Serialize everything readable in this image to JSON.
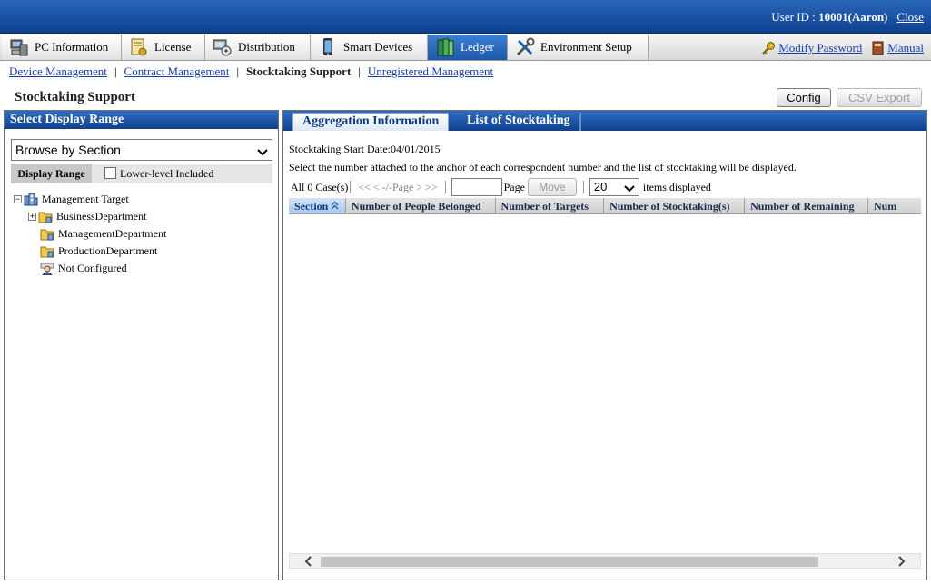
{
  "header": {
    "user_label": "User ID : ",
    "user_value": "10001(Aaron)",
    "close_label": "Close"
  },
  "main_tabs": [
    {
      "label": "PC Information",
      "icon": "pc-icon"
    },
    {
      "label": "License",
      "icon": "license-icon"
    },
    {
      "label": "Distribution",
      "icon": "distribution-icon"
    },
    {
      "label": "Smart Devices",
      "icon": "smart-device-icon"
    },
    {
      "label": "Ledger",
      "icon": "ledger-icon",
      "active": true
    },
    {
      "label": "Environment Setup",
      "icon": "tools-icon"
    }
  ],
  "top_links": {
    "modify_password": "Modify Password",
    "manual": "Manual"
  },
  "subnav": {
    "device_management": "Device Management",
    "contract_management": "Contract Management",
    "stocktaking_support": "Stocktaking Support",
    "unregistered_management": "Unregistered Management"
  },
  "page": {
    "title": "Stocktaking Support",
    "config_label": "Config",
    "csv_export_label": "CSV Export"
  },
  "left_panel": {
    "title": "Select Display Range",
    "browse_selected": "Browse by Section",
    "display_range_label": "Display Range",
    "lower_level_label": "Lower-level Included",
    "tree": {
      "root": "Management Target",
      "items": [
        "BusinessDepartment",
        "ManagementDepartment",
        "ProductionDepartment",
        "Not Configured"
      ]
    }
  },
  "right_panel": {
    "tabs": [
      "Aggregation Information",
      "List of Stocktaking"
    ],
    "start_date": "Stocktaking Start Date:04/01/2015",
    "instruction": "Select the number attached to the anchor of each correspondent number and the list of stocktaking will be displayed.",
    "pager": {
      "count": "All 0 Case(s)",
      "nav": "<< < -/-Page > >>",
      "page_label": "Page",
      "move_label": "Move",
      "per_page": "20",
      "items_label": "items displayed"
    },
    "columns": [
      "Section",
      "Number of People Belonged",
      "Number of Targets",
      "Number of Stocktaking(s)",
      "Number of Remaining",
      "Num"
    ]
  },
  "colors": {
    "header_blue": "#1c57aa",
    "link_blue": "#1a3fb0"
  }
}
